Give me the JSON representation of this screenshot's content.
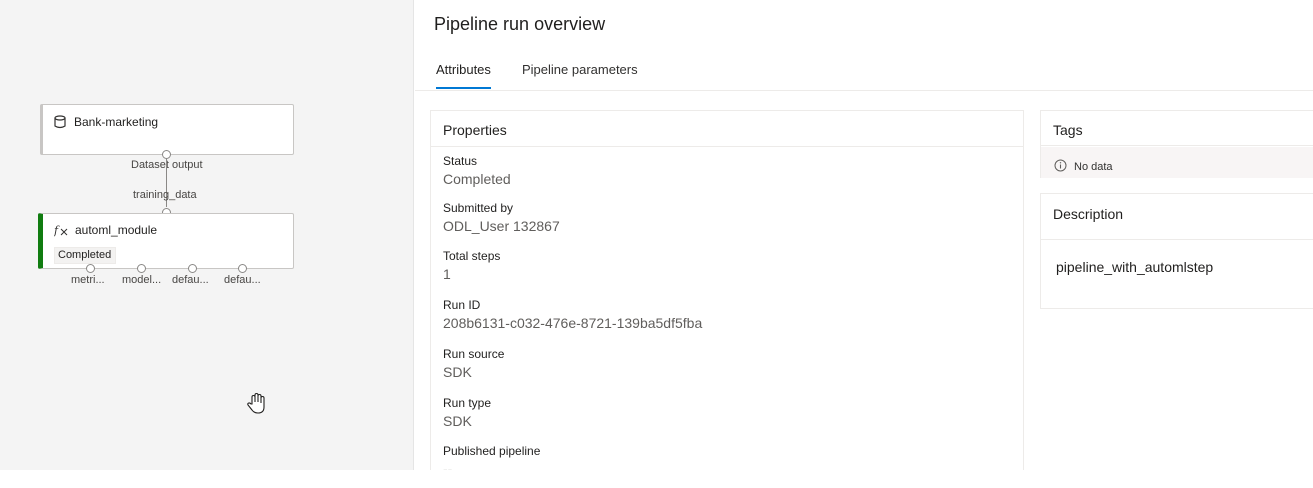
{
  "canvas": {
    "dataset_node": {
      "label": "Bank-marketing",
      "output_label": "Dataset output"
    },
    "connector_label": "training_data",
    "module_node": {
      "label": "automl_module",
      "status": "Completed",
      "outputs": [
        "metri...",
        "model...",
        "defau...",
        "defau..."
      ]
    }
  },
  "panel": {
    "title": "Pipeline run overview",
    "tabs": [
      {
        "label": "Attributes",
        "active": true
      },
      {
        "label": "Pipeline parameters",
        "active": false
      }
    ],
    "properties": {
      "header": "Properties",
      "items": [
        {
          "label": "Status",
          "value": "Completed"
        },
        {
          "label": "Submitted by",
          "value": "ODL_User 132867"
        },
        {
          "label": "Total steps",
          "value": "1"
        },
        {
          "label": "Run ID",
          "value": "208b6131-c032-476e-8721-139ba5df5fba"
        },
        {
          "label": "Run source",
          "value": "SDK"
        },
        {
          "label": "Run type",
          "value": "SDK"
        },
        {
          "label": "Published pipeline",
          "value": "--"
        }
      ]
    },
    "tags": {
      "header": "Tags",
      "empty_text": "No data"
    },
    "description": {
      "header": "Description",
      "text": "pipeline_with_automlstep"
    }
  },
  "colors": {
    "accent": "#0078d4",
    "success": "#107c10"
  },
  "icons": [
    "dataset-icon",
    "module-icon",
    "info-icon",
    "hand-cursor-icon"
  ]
}
